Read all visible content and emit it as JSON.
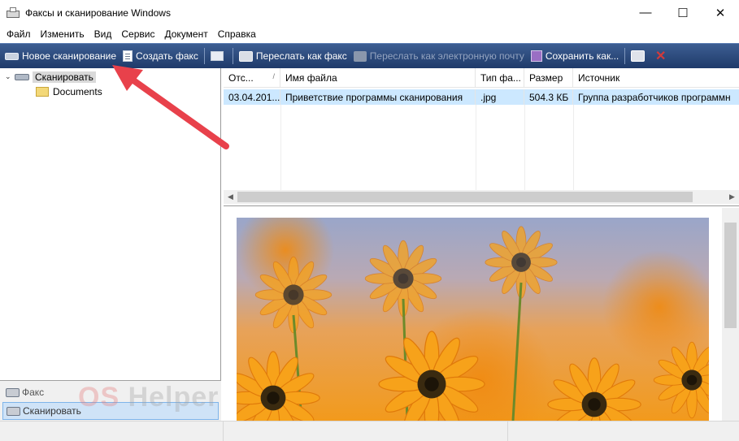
{
  "window": {
    "title": "Факсы и сканирование Windows",
    "minimize": "—",
    "maximize": "☐",
    "close": "✕"
  },
  "menu": [
    "Файл",
    "Изменить",
    "Вид",
    "Сервис",
    "Документ",
    "Справка"
  ],
  "toolbar": {
    "new_scan": "Новое сканирование",
    "create_fax": "Создать факс",
    "forward_fax": "Переслать как факс",
    "forward_email": "Переслать как электронную почту",
    "save_as": "Сохранить как..."
  },
  "tree": {
    "root": "Сканировать",
    "child": "Documents",
    "toggle": "⌄"
  },
  "nav": {
    "fax": "Факс",
    "scan": "Сканировать"
  },
  "list": {
    "columns": [
      "Отс...",
      "Имя файла",
      "Тип фа...",
      "Размер",
      "Источник"
    ],
    "sort_arrow": "/",
    "rows": [
      {
        "date": "03.04.201...",
        "name": "Приветствие программы сканирования",
        "type": ".jpg",
        "size": "504.3 КБ",
        "source": "Группа разработчиков программн"
      }
    ],
    "scroll_left": "◀",
    "scroll_right": "▶"
  },
  "watermark": {
    "os": "OS",
    "helper": " Helper"
  },
  "colors": {
    "toolbar": "#2b4a7e",
    "selection": "#cce8ff",
    "arrow": "#e8414b",
    "flower": "#f29a1c"
  }
}
